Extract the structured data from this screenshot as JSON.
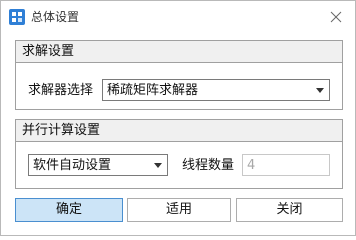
{
  "window": {
    "title": "总体设置",
    "icon": "app-grid-icon",
    "close_icon": "close-icon"
  },
  "solver_group": {
    "header": "求解设置",
    "label": "求解器选择",
    "selected": "稀疏矩阵求解器"
  },
  "parallel_group": {
    "header": "并行计算设置",
    "mode_selected": "软件自动设置",
    "threads_label": "线程数量",
    "threads_value": "4"
  },
  "buttons": {
    "ok": "确定",
    "apply": "适用",
    "close": "关闭"
  },
  "colors": {
    "accent": "#2f7fd6",
    "primary_button_bg": "#cce4f7",
    "group_header_bg": "#f0f0f0"
  }
}
